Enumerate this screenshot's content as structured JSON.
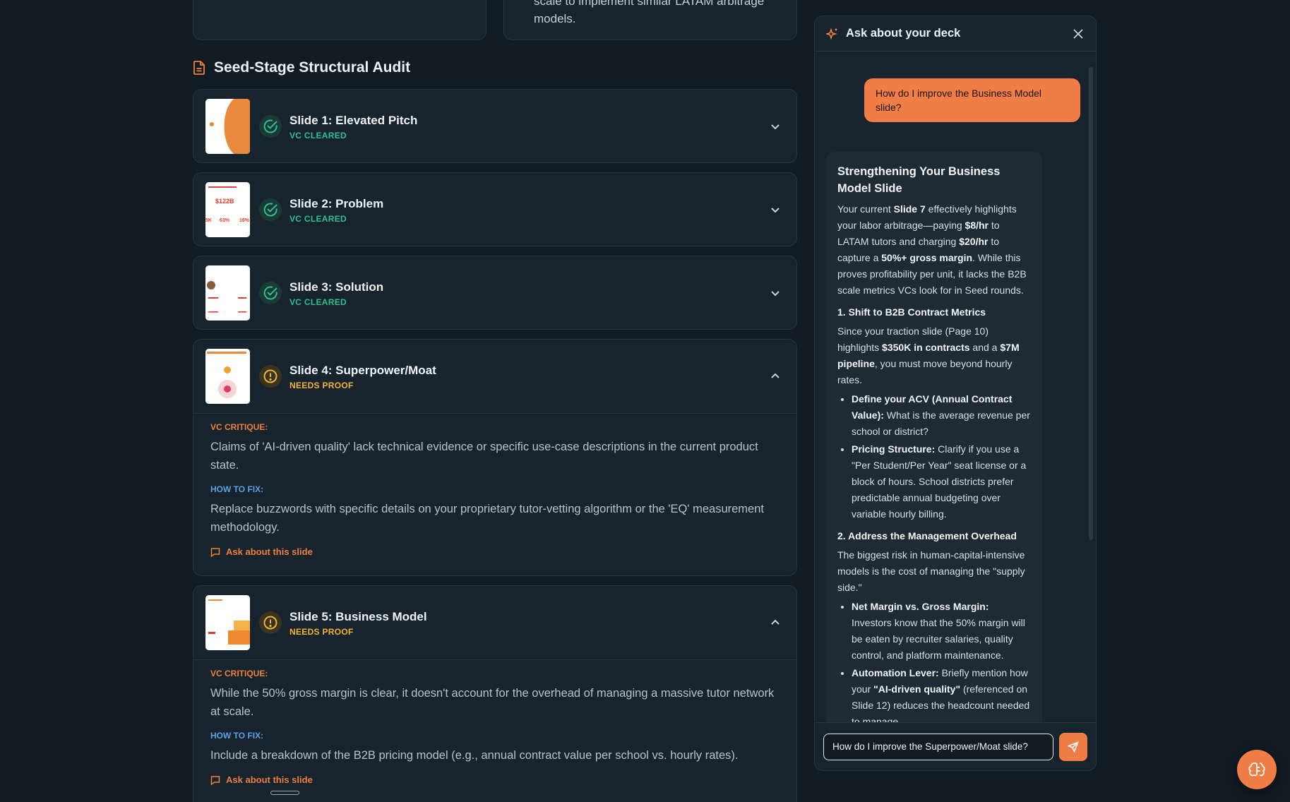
{
  "top_cards": {
    "right_text": "scale to implement similar LATAM arbitrage models."
  },
  "section": {
    "title": "Seed-Stage Structural Audit"
  },
  "slides": [
    {
      "title": "Slide 1: Elevated Pitch",
      "status": "VC CLEARED"
    },
    {
      "title": "Slide 2: Problem",
      "status": "VC CLEARED",
      "thumb_stats": [
        "$122B",
        "5K",
        "63%",
        "16%"
      ]
    },
    {
      "title": "Slide 3: Solution",
      "status": "VC CLEARED"
    },
    {
      "title": "Slide 4: Superpower/Moat",
      "status": "NEEDS PROOF",
      "critique_label": "VC CRITIQUE:",
      "critique": "Claims of 'AI-driven quality' lack technical evidence or specific use-case descriptions in the current product state.",
      "fix_label": "HOW TO FIX:",
      "fix": "Replace buzzwords with specific details on your proprietary tutor-vetting algorithm or the 'EQ' measurement methodology.",
      "ask": "Ask about this slide"
    },
    {
      "title": "Slide 5: Business Model",
      "status": "NEEDS PROOF",
      "critique_label": "VC CRITIQUE:",
      "critique": "While the 50% gross margin is clear, it doesn't account for the overhead of managing a massive tutor network at scale.",
      "fix_label": "HOW TO FIX:",
      "fix": "Include a breakdown of the B2B pricing model (e.g., annual contract value per school vs. hourly rates).",
      "ask": "Ask about this slide"
    }
  ],
  "chat": {
    "title": "Ask about your deck",
    "user_message": "How do I improve the Business Model slide?",
    "response": {
      "heading": "Strengthening Your Business Model Slide",
      "intro": {
        "t1": "Your current ",
        "b1": "Slide 7",
        "t2": " effectively highlights your labor arbitrage—paying ",
        "b2": "$8/hr",
        "t3": " to LATAM tutors and charging ",
        "b3": "$20/hr",
        "t4": " to capture a ",
        "b4": "50%+ gross margin",
        "t5": ". While this proves profitability per unit, it lacks the B2B scale metrics VCs look for in Seed rounds."
      },
      "section1": {
        "heading": "1. Shift to B2B Contract Metrics",
        "t1": "Since your traction slide (Page 10) highlights ",
        "b1": "$350K in contracts",
        "t2": " and a ",
        "b2": "$7M pipeline",
        "t3": ", you must move beyond hourly rates.",
        "bullets": [
          {
            "bold": "Define your ACV (Annual Contract Value):",
            "text": " What is the average revenue per school or district?"
          },
          {
            "bold": "Pricing Structure:",
            "text": " Clarify if you use a \"Per Student/Per Year\" seat license or a block of hours. School districts prefer predictable annual budgeting over variable hourly billing."
          }
        ]
      },
      "section2": {
        "heading": "2. Address the Management Overhead",
        "text": "The biggest risk in human-capital-intensive models is the cost of managing the \"supply side.\"",
        "bullets": [
          {
            "bold": "Net Margin vs. Gross Margin:",
            "text": " Investors know that the 50% margin will be eaten by recruiter salaries, quality control, and platform maintenance."
          },
          {
            "bold": "Automation Lever:",
            "text": " Briefly mention how your ",
            "bold2": "\"AI-driven quality\"",
            "text2": " (referenced on Slide 12) reduces the headcount needed to manage"
          }
        ]
      }
    },
    "input_value": "How do I improve the Superpower/Moat slide?"
  },
  "colors": {
    "accent": "#ef7d45",
    "cleared": "#2fbf8f",
    "needs_proof": "#f2b333",
    "fix_label": "#5aa3e6"
  }
}
